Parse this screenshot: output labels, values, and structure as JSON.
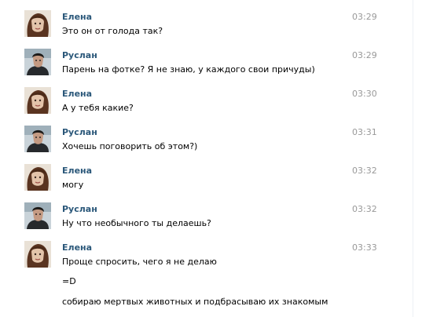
{
  "messages": [
    {
      "author": "Елена",
      "time": "03:29",
      "lines": [
        "Это он от голода так?"
      ],
      "avatar": "elena-avatar"
    },
    {
      "author": "Руслан",
      "time": "03:29",
      "lines": [
        "Парень на фотке? Я не знаю, у каждого свои причуды)"
      ],
      "avatar": "ruslan-avatar"
    },
    {
      "author": "Елена",
      "time": "03:30",
      "lines": [
        "А у тебя какие?"
      ],
      "avatar": "elena-avatar"
    },
    {
      "author": "Руслан",
      "time": "03:31",
      "lines": [
        "Хочешь поговорить об этом?)"
      ],
      "avatar": "ruslan-avatar"
    },
    {
      "author": "Елена",
      "time": "03:32",
      "lines": [
        "могу"
      ],
      "avatar": "elena-avatar"
    },
    {
      "author": "Руслан",
      "time": "03:32",
      "lines": [
        "Ну что необычного ты делаешь?"
      ],
      "avatar": "ruslan-avatar"
    },
    {
      "author": "Елена",
      "time": "03:33",
      "lines": [
        "Проще спросить, чего я не делаю",
        "=D",
        "собираю мертвых животных и подбрасываю их знакомым"
      ],
      "avatar": "elena-avatar"
    }
  ],
  "colors": {
    "author": "#2b587a",
    "time": "#999999",
    "text": "#000000"
  }
}
